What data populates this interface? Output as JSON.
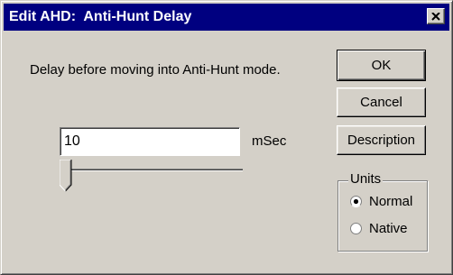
{
  "window": {
    "title": "Edit AHD:  Anti-Hunt Delay"
  },
  "description": "Delay before moving into Anti-Hunt mode.",
  "delay_input": {
    "value": "10",
    "unit": "mSec"
  },
  "slider": {
    "level": 0
  },
  "buttons": {
    "ok": "OK",
    "cancel": "Cancel",
    "description": "Description"
  },
  "units_group": {
    "label": "Units",
    "options": [
      {
        "label": "Normal",
        "selected": true
      },
      {
        "label": "Native",
        "selected": false
      }
    ]
  },
  "icons": {
    "close": "close-icon",
    "slider_thumb": "slider-thumb-icon"
  },
  "colors": {
    "titlebar": "#000080",
    "face": "#d4d0c8"
  }
}
